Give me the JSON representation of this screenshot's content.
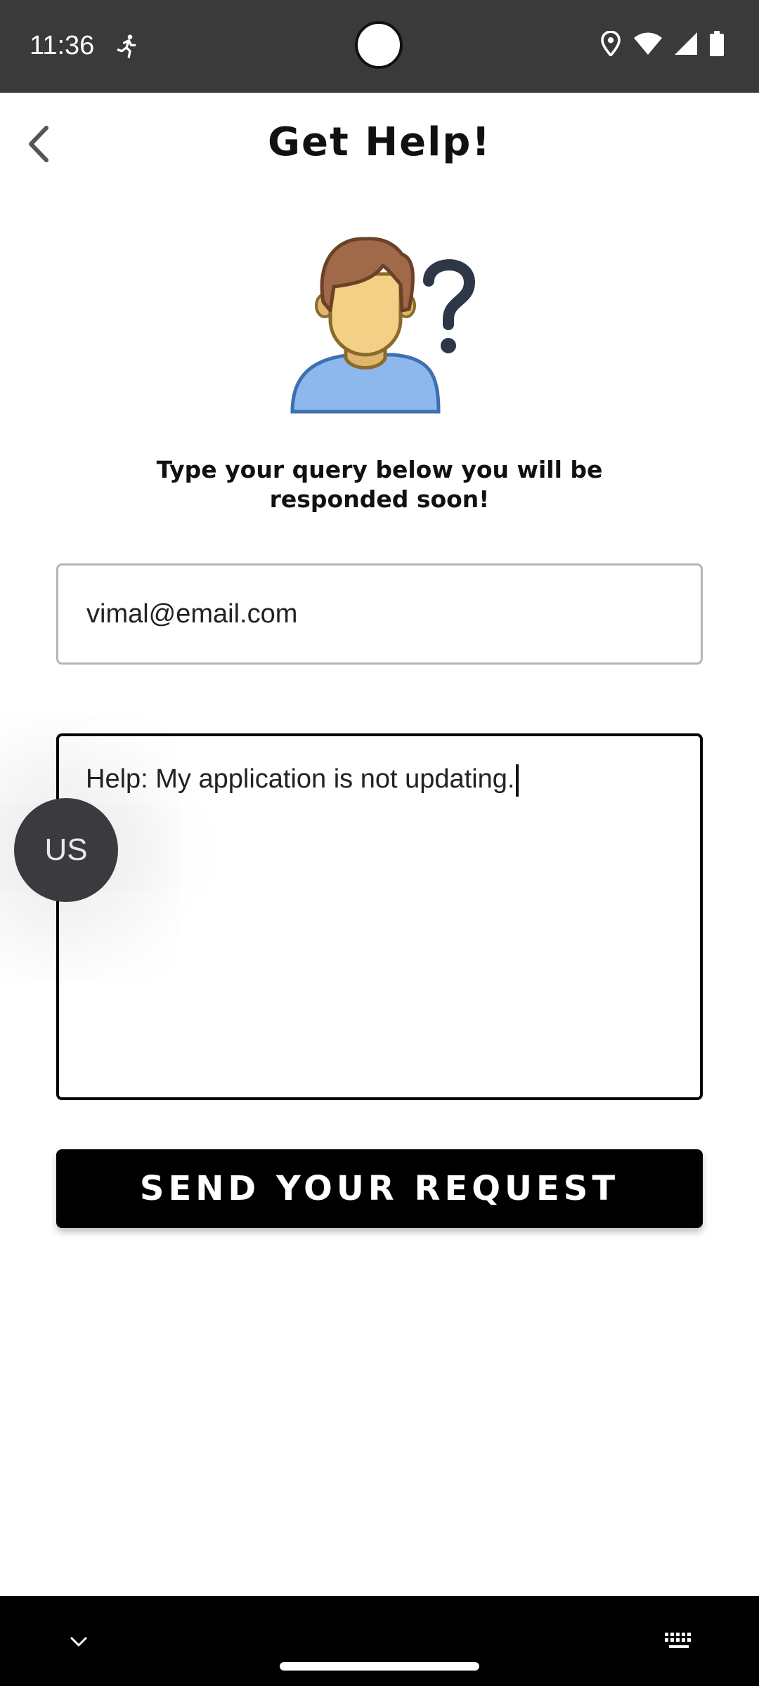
{
  "status_bar": {
    "time": "11:36",
    "icons": [
      "running-icon",
      "location-icon",
      "wifi-icon",
      "signal-icon",
      "battery-icon"
    ]
  },
  "app_bar": {
    "title": "Get Help!",
    "back_icon": "back-arrow-icon"
  },
  "main": {
    "illustration_icon": "help-person-question-icon",
    "subtitle": "Type your query below you will be responded soon!",
    "email_value": "vimal@email.com",
    "message_value": "Help: My application is not updating.",
    "send_label": "SEND YOUR REQUEST"
  },
  "floating_bubble": {
    "label": "US"
  },
  "nav_bar": {
    "icons": [
      "chevron-down-icon",
      "keyboard-icon"
    ]
  },
  "colors": {
    "status_bar": "#3a3a3a",
    "button": "#000000",
    "hair": "#a0694a",
    "face": "#f4cf86",
    "shirt": "#8cb8ee",
    "question_mark": "#2d3748"
  }
}
